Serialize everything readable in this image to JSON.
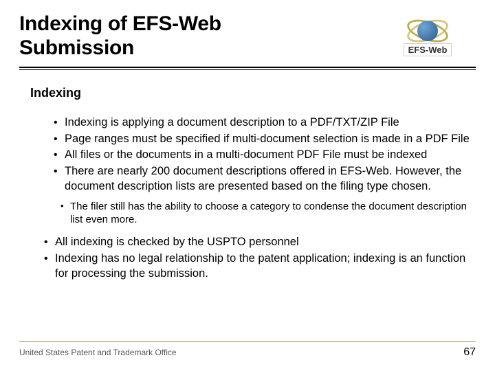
{
  "header": {
    "title_line1": "Indexing of EFS-Web",
    "title_line2": "Submission",
    "logo_text": "EFS-Web"
  },
  "body": {
    "section_heading": "Indexing",
    "bullets_lvl1": [
      "Indexing is applying a document description to a PDF/TXT/ZIP File",
      "Page ranges must be specified if multi-document selection is made in a PDF File",
      "All files or the documents in a multi-document PDF File must be indexed",
      "There are nearly 200 document descriptions offered in EFS-Web. However, the document description lists are presented based on the filing type chosen."
    ],
    "bullets_lvl2": [
      "The filer still has the ability to choose a category to condense the document description list even more."
    ],
    "bullets_lvl0": [
      "All indexing is checked by the USPTO personnel",
      "Indexing has no legal relationship to the patent application; indexing is an function for processing the submission."
    ]
  },
  "footer": {
    "left": "United States Patent and Trademark Office",
    "page_number": "67"
  }
}
